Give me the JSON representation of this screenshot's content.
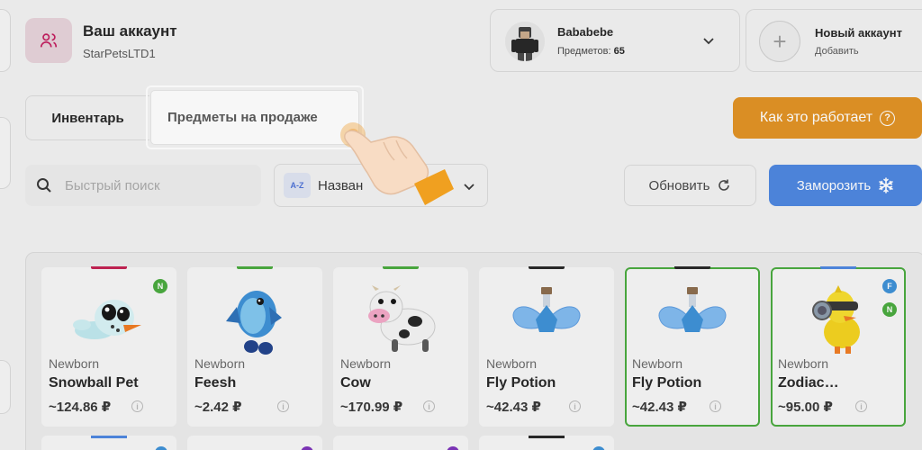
{
  "account": {
    "title": "Ваш аккаунт",
    "subtitle": "StarPetsLTD1"
  },
  "user": {
    "name": "Bababebe",
    "items_label": "Предметов:",
    "items_count": "65"
  },
  "new_account": {
    "title": "Новый аккаунт",
    "subtitle": "Добавить"
  },
  "tabs": {
    "inventory": "Инвентарь",
    "on_sale": "Предметы на продаже"
  },
  "how_it_works": "Как это работает",
  "search": {
    "placeholder": "Быстрый поиск"
  },
  "sort": {
    "badge": "A-Z",
    "label": "Назван"
  },
  "refresh_label": "Обновить",
  "freeze_label": "Заморозить",
  "items": [
    {
      "age": "Newborn",
      "name": "Snowball Pet",
      "price": "~124.86 ₽",
      "bar_color": "#c21d4e",
      "badges": [
        "N"
      ],
      "selected": false
    },
    {
      "age": "Newborn",
      "name": "Feesh",
      "price": "~2.42 ₽",
      "bar_color": "#46a83a",
      "badges": [],
      "selected": false
    },
    {
      "age": "Newborn",
      "name": "Cow",
      "price": "~170.99 ₽",
      "bar_color": "#46a83a",
      "badges": [],
      "selected": false
    },
    {
      "age": "Newborn",
      "name": "Fly Potion",
      "price": "~42.43 ₽",
      "bar_color": "#222222",
      "badges": [],
      "selected": false
    },
    {
      "age": "Newborn",
      "name": "Fly Potion",
      "price": "~42.43 ₽",
      "bar_color": "#222222",
      "badges": [],
      "selected": true
    },
    {
      "age": "Newborn",
      "name": "Zodiac…",
      "price": "~95.00 ₽",
      "bar_color": "#4a84e0",
      "badges": [
        "F",
        "N"
      ],
      "selected": true
    }
  ],
  "colors": {
    "accent_orange": "#e1901f",
    "accent_blue": "#4a84e0",
    "selected_green": "#46a83a"
  }
}
